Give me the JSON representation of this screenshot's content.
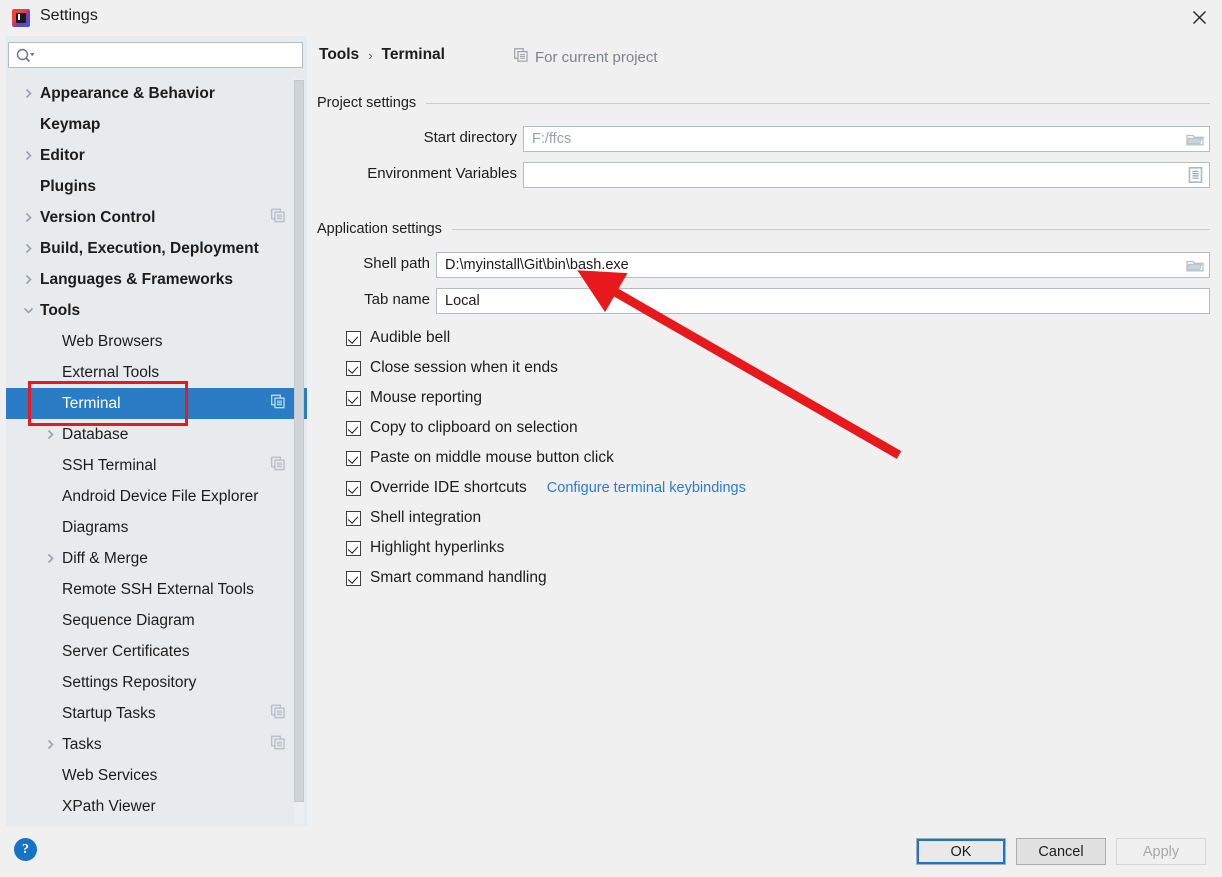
{
  "window": {
    "title": "Settings",
    "app_icon": "intellij-idea-icon",
    "close_icon": "close-icon"
  },
  "sidebar": {
    "search": {
      "placeholder": "",
      "value": "",
      "icon": "search-icon"
    },
    "items": [
      {
        "label": "Appearance & Behavior",
        "level": "top",
        "expandable": true,
        "expanded": false,
        "badge": false
      },
      {
        "label": "Keymap",
        "level": "top",
        "expandable": false,
        "expanded": false,
        "badge": false
      },
      {
        "label": "Editor",
        "level": "top",
        "expandable": true,
        "expanded": false,
        "badge": false
      },
      {
        "label": "Plugins",
        "level": "top",
        "expandable": false,
        "expanded": false,
        "badge": false
      },
      {
        "label": "Version Control",
        "level": "top",
        "expandable": true,
        "expanded": false,
        "badge": true
      },
      {
        "label": "Build, Execution, Deployment",
        "level": "top",
        "expandable": true,
        "expanded": false,
        "badge": false
      },
      {
        "label": "Languages & Frameworks",
        "level": "top",
        "expandable": true,
        "expanded": false,
        "badge": false
      },
      {
        "label": "Tools",
        "level": "top",
        "expandable": true,
        "expanded": true,
        "badge": false
      },
      {
        "label": "Web Browsers",
        "level": "child",
        "expandable": false,
        "expanded": false,
        "badge": false
      },
      {
        "label": "External Tools",
        "level": "child",
        "expandable": false,
        "expanded": false,
        "badge": false
      },
      {
        "label": "Terminal",
        "level": "child",
        "expandable": false,
        "expanded": false,
        "badge": true,
        "selected": true
      },
      {
        "label": "Database",
        "level": "child",
        "expandable": true,
        "expanded": false,
        "badge": false
      },
      {
        "label": "SSH Terminal",
        "level": "child",
        "expandable": false,
        "expanded": false,
        "badge": true
      },
      {
        "label": "Android Device File Explorer",
        "level": "child",
        "expandable": false,
        "expanded": false,
        "badge": false
      },
      {
        "label": "Diagrams",
        "level": "child",
        "expandable": false,
        "expanded": false,
        "badge": false
      },
      {
        "label": "Diff & Merge",
        "level": "child",
        "expandable": true,
        "expanded": false,
        "badge": false
      },
      {
        "label": "Remote SSH External Tools",
        "level": "child",
        "expandable": false,
        "expanded": false,
        "badge": false
      },
      {
        "label": "Sequence Diagram",
        "level": "child",
        "expandable": false,
        "expanded": false,
        "badge": false
      },
      {
        "label": "Server Certificates",
        "level": "child",
        "expandable": false,
        "expanded": false,
        "badge": false
      },
      {
        "label": "Settings Repository",
        "level": "child",
        "expandable": false,
        "expanded": false,
        "badge": false
      },
      {
        "label": "Startup Tasks",
        "level": "child",
        "expandable": false,
        "expanded": false,
        "badge": true
      },
      {
        "label": "Tasks",
        "level": "child",
        "expandable": true,
        "expanded": false,
        "badge": true
      },
      {
        "label": "Web Services",
        "level": "child",
        "expandable": false,
        "expanded": false,
        "badge": false
      },
      {
        "label": "XPath Viewer",
        "level": "child",
        "expandable": false,
        "expanded": false,
        "badge": false
      }
    ]
  },
  "main": {
    "breadcrumb": {
      "parent": "Tools",
      "separator": "›",
      "current": "Terminal"
    },
    "for_current_project": {
      "label": "For current project",
      "icon": "copy-badge-icon"
    },
    "project_settings": {
      "title": "Project settings",
      "start_directory": {
        "label": "Start directory",
        "value": "F:/ffcs",
        "muted": true,
        "button_icon": "folder-icon"
      },
      "environment_variables": {
        "label": "Environment Variables",
        "value": "",
        "muted": false,
        "button_icon": "list-document-icon"
      }
    },
    "application_settings": {
      "title": "Application settings",
      "shell_path": {
        "label": "Shell path",
        "value": "D:\\myinstall\\Git\\bin\\bash.exe",
        "muted": false,
        "button_icon": "folder-icon"
      },
      "tab_name": {
        "label": "Tab name",
        "value": "Local",
        "muted": false
      },
      "checkboxes": [
        {
          "label": "Audible bell",
          "checked": true
        },
        {
          "label": "Close session when it ends",
          "checked": true
        },
        {
          "label": "Mouse reporting",
          "checked": true
        },
        {
          "label": "Copy to clipboard on selection",
          "checked": true
        },
        {
          "label": "Paste on middle mouse button click",
          "checked": true
        },
        {
          "label": "Override IDE shortcuts",
          "checked": true,
          "link": "Configure terminal keybindings"
        },
        {
          "label": "Shell integration",
          "checked": true
        },
        {
          "label": "Highlight hyperlinks",
          "checked": true
        },
        {
          "label": "Smart command handling",
          "checked": true
        }
      ]
    }
  },
  "footer": {
    "help_label": "?",
    "ok_label": "OK",
    "cancel_label": "Cancel",
    "apply_label": "Apply"
  },
  "annotations": {
    "highlight_box_color": "#e8191c",
    "arrow_color": "#e8191c",
    "link_color": "#2b7cd0",
    "selection_color": "#2a7dc4"
  }
}
